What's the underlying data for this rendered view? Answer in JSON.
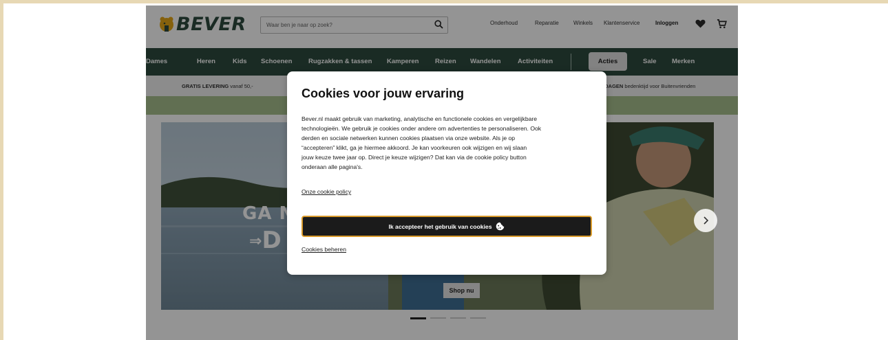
{
  "brand": {
    "name": "BEVER",
    "color": "#2d4b3f",
    "accent": "#e6a817"
  },
  "search": {
    "placeholder": "Waar ben je naar op zoek?",
    "icon": "search-icon"
  },
  "top_links": [
    "Onderhoud",
    "Reparatie",
    "Winkels",
    "Klantenservice",
    "Inloggen"
  ],
  "icons": {
    "wishlist": "heart-icon",
    "cart": "cart-icon",
    "cookie": "cookie-icon",
    "next": "chevron-right-icon"
  },
  "nav": {
    "items": [
      "Dames",
      "Heren",
      "Kids",
      "Schoenen",
      "Rugzakken & tassen",
      "Kamperen",
      "Reizen",
      "Wandelen",
      "Activiteiten"
    ],
    "highlight": "Acties",
    "extra": [
      "Sale",
      "Merken"
    ]
  },
  "usp": {
    "delivery_bold": "GRATIS LEVERING",
    "delivery_rest": " vanaf 50,-",
    "days_bold": "5 DAGEN",
    "days_rest": " bedenktijd voor Buitenvrienden"
  },
  "hero": {
    "title": "GA NA",
    "subtitle": "D",
    "button": "Shop nu",
    "slide_count": 4,
    "active_slide": 1
  },
  "cookie_modal": {
    "title": "Cookies voor jouw ervaring",
    "lines": [
      "Bever.nl maakt gebruik van marketing, analytische en functionele cookies en vergelijkbare",
      "technologieën. We gebruik je cookies onder andere om advertenties te personaliseren. Ook",
      "derden en sociale netwerken kunnen cookies plaatsen via onze website. Als je op",
      "“accepteren” klikt, ga je hiermee akkoord. Je kan voorkeuren ook wijzigen en wij slaan",
      "jouw keuze twee jaar op. Direct je keuze wijzigen? Dat kan via de cookie policy button",
      "onderaan alle pagina's."
    ],
    "policy_link": "Onze cookie policy",
    "accept_label": "Ik accepteer het gebruik van cookies",
    "manage_label": "Cookies beheren"
  }
}
